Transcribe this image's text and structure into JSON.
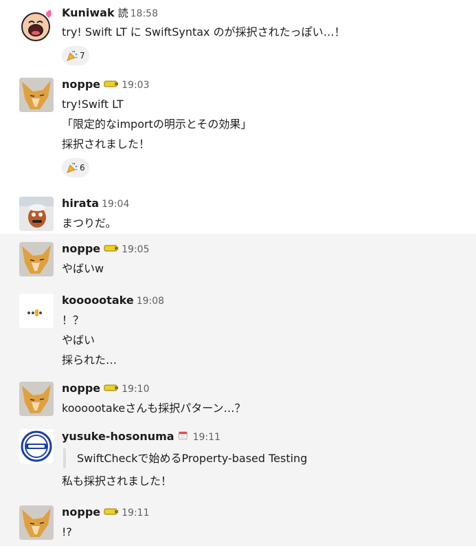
{
  "messages": [
    {
      "user": "Kuniwak",
      "status_text": "読",
      "time": "18:58",
      "lines": [
        "try! Swift LT に SwiftSyntax のが採択されたっぽい…！"
      ],
      "reaction": {
        "icon": "party-popper",
        "count": "7"
      }
    },
    {
      "user": "noppe",
      "time": "19:03",
      "lines": [
        "try!Swift LT",
        "「限定的なimportの明示とその効果」",
        "採択されました！"
      ],
      "reaction": {
        "icon": "party-popper",
        "count": "6"
      }
    },
    {
      "user": "hirata",
      "time": "19:04",
      "lines": [
        "まつりだ。"
      ]
    },
    {
      "user": "noppe",
      "time": "19:05",
      "lines": [
        "やばいw"
      ]
    },
    {
      "user": "koooootake",
      "time": "19:08",
      "lines": [
        "！？",
        "やばい",
        "採られた…"
      ]
    },
    {
      "user": "noppe",
      "time": "19:10",
      "lines": [
        "koooootakeさんも採択パターン…？"
      ]
    },
    {
      "user": "yusuke-hosonuma",
      "time": "19:11",
      "quote": "SwiftCheckで始めるProperty-based Testing",
      "lines": [
        "私も採択されました！"
      ]
    },
    {
      "user": "noppe",
      "time": "19:11",
      "lines": [
        "!?"
      ]
    }
  ],
  "colors": {
    "text": "#1d1c1d",
    "timestamp": "#616061",
    "hover_background": "#f4f4f4",
    "reaction_background": "#f0f0f0",
    "quote_bar": "#dddddd"
  }
}
